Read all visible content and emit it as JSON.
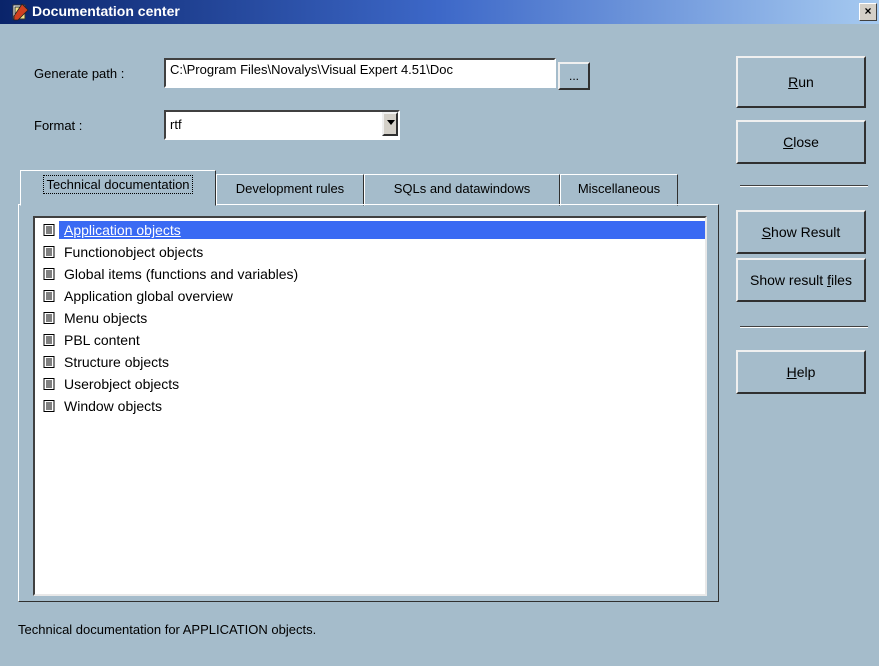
{
  "window": {
    "title": "Documentation center",
    "close_glyph": "×"
  },
  "form": {
    "generate_path_label": "Generate path :",
    "generate_path_value": "C:\\Program Files\\Novalys\\Visual Expert 4.51\\Doc",
    "browse_label": "...",
    "format_label": "Format :",
    "format_value": "rtf"
  },
  "tabs": [
    {
      "label": "Technical documentation",
      "active": true
    },
    {
      "label": "Development rules",
      "active": false
    },
    {
      "label": "SQLs and datawindows",
      "active": false
    },
    {
      "label": "Miscellaneous",
      "active": false
    }
  ],
  "list": {
    "items": [
      {
        "label": "Application objects",
        "selected": true,
        "icon": "document-icon"
      },
      {
        "label": "Functionobject objects",
        "selected": false,
        "icon": "document-icon"
      },
      {
        "label": "Global items (functions and variables)",
        "selected": false,
        "icon": "document-icon"
      },
      {
        "label": "Application global overview",
        "selected": false,
        "icon": "document-icon"
      },
      {
        "label": "Menu objects",
        "selected": false,
        "icon": "document-icon"
      },
      {
        "label": "PBL content",
        "selected": false,
        "icon": "document-icon"
      },
      {
        "label": "Structure objects",
        "selected": false,
        "icon": "document-icon"
      },
      {
        "label": "Userobject objects",
        "selected": false,
        "icon": "document-icon"
      },
      {
        "label": "Window objects",
        "selected": false,
        "icon": "document-icon"
      }
    ]
  },
  "buttons": {
    "run": {
      "pre": "",
      "u": "R",
      "post": "un"
    },
    "close": {
      "pre": "",
      "u": "C",
      "post": "lose"
    },
    "show_result": {
      "pre": "",
      "u": "S",
      "post": "how Result"
    },
    "show_result_files": {
      "pre": "Show result ",
      "u": "f",
      "post": "iles"
    },
    "help": {
      "pre": "",
      "u": "H",
      "post": "elp"
    }
  },
  "status_text": "Technical documentation for APPLICATION objects.",
  "colors": {
    "background": "#a5bccb",
    "titlebar_start": "#0a246a",
    "titlebar_end": "#a6caf0",
    "selection": "#3a6af3"
  }
}
